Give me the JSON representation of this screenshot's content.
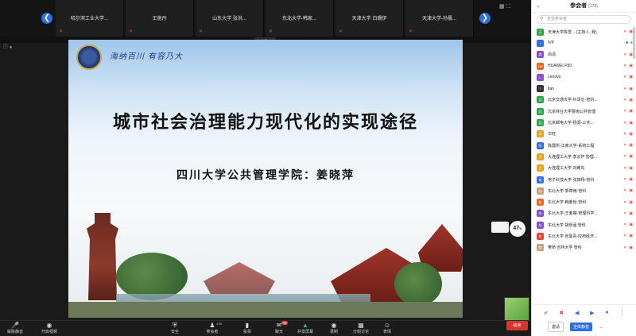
{
  "strip": {
    "tiles": [
      {
        "name": "哈尔滨工业大学...",
        "muted": true
      },
      {
        "name": "王施丹",
        "muted": true
      },
      {
        "name": "山东大学 张洪...",
        "muted": true
      },
      {
        "name": "东北大学-韩家...",
        "muted": true
      },
      {
        "name": "天津大学 白珊伊",
        "muted": true
      },
      {
        "name": "天津大学-孙晨...",
        "muted": true
      }
    ],
    "prev_icon": "chevron-left-icon",
    "next_icon": "chevron-right-icon"
  },
  "share": {
    "badge": "AudioSmart",
    "slide": {
      "motto": "海纳百川 有容乃大",
      "title": "城市社会治理能力现代化的实现途径",
      "subtitle": "四川大学公共管理学院：姜晓萍"
    },
    "score": "47",
    "score_unit": "%"
  },
  "toolbar": {
    "items": [
      {
        "id": "mute",
        "label": "解除静音",
        "icon": "mic-off-icon"
      },
      {
        "id": "video",
        "label": "开启视频",
        "icon": "camera-icon"
      },
      {
        "id": "security",
        "label": "安全",
        "icon": "shield-icon"
      },
      {
        "id": "participants",
        "label": "参会者",
        "icon": "people-icon",
        "count": "178"
      },
      {
        "id": "polls",
        "label": "投票",
        "icon": "bar-chart-icon"
      },
      {
        "id": "chat",
        "label": "聊天",
        "icon": "chat-icon",
        "badge": "99"
      },
      {
        "id": "share",
        "label": "共享屏幕",
        "icon": "share-screen-icon"
      },
      {
        "id": "record",
        "label": "录制",
        "icon": "record-icon"
      },
      {
        "id": "breakout",
        "label": "分组讨论",
        "icon": "breakout-icon"
      },
      {
        "id": "reactions",
        "label": "表情",
        "icon": "emoji-icon"
      }
    ],
    "end_label": "结束"
  },
  "panel": {
    "title": "参会者",
    "count": "(178)",
    "search_placeholder": "查找参会者",
    "participants": [
      {
        "name": "天津大学陈雪... (主持人, 我)",
        "color": "#2aa84a",
        "initial": "天",
        "status": "muted"
      },
      {
        "name": "IVP",
        "color": "#2f6fe0",
        "initial": "I",
        "status": "on"
      },
      {
        "name": "尚清",
        "color": "#8a4fd0",
        "initial": "尚",
        "status": "muted"
      },
      {
        "name": "HUAWEI P30",
        "color": "#e86a1f",
        "initial": "HP",
        "status": "muted"
      },
      {
        "name": "Lenovo",
        "color": "#8a4fd0",
        "initial": "L",
        "status": "muted"
      },
      {
        "name": "tian",
        "color": "#333333",
        "initial": "T",
        "status": "muted"
      },
      {
        "name": "北京交通大学-许泽壮-管科...",
        "color": "#2aa84a",
        "initial": "北",
        "status": "muted"
      },
      {
        "name": "北京林业大学曹雨公共管理",
        "color": "#2aa84a",
        "initial": "北",
        "status": "muted"
      },
      {
        "name": "北京邮电大学-杨源-公共...",
        "color": "#2aa84a",
        "initial": "北",
        "status": "muted"
      },
      {
        "name": "华旺",
        "color": "#e8a21f",
        "initial": "华",
        "status": "muted"
      },
      {
        "name": "陈霞所-江南大学-系统工程",
        "color": "#2f6fe0",
        "initial": "陈",
        "status": "muted"
      },
      {
        "name": "大连理工大学 李云轩 管理...",
        "color": "#e8a21f",
        "initial": "大",
        "status": "muted"
      },
      {
        "name": "大连理工大学 刘耀东",
        "color": "#e8a21f",
        "initial": "大",
        "status": "muted"
      },
      {
        "name": "电子科技大学-张婧杨-管科",
        "color": "#2f6fe0",
        "initial": "电",
        "status": "muted"
      },
      {
        "name": "东北大学-郭田雨-管科",
        "color": "#c9a07a",
        "initial": "东",
        "status": "muted"
      },
      {
        "name": "东北大学-韩紫怡-管科",
        "color": "#e86a1f",
        "initial": "东",
        "status": "muted"
      },
      {
        "name": "东北大学-王紫薇-管理科学...",
        "color": "#8a4fd0",
        "initial": "东",
        "status": "muted"
      },
      {
        "name": "东北大学 胡玥涵 管科",
        "color": "#8a4fd0",
        "initial": "东",
        "status": "muted"
      },
      {
        "name": "东北大学 张曼青-应用经济...",
        "color": "#e8443a",
        "initial": "东",
        "status": "muted"
      },
      {
        "name": "樊娇 吉林大学 管科",
        "color": "#c9a07a",
        "initial": "樊",
        "status": "muted"
      }
    ],
    "footer": {
      "invite_label": "邀请",
      "mute_all_label": "全体静音",
      "more_label": "..."
    }
  }
}
